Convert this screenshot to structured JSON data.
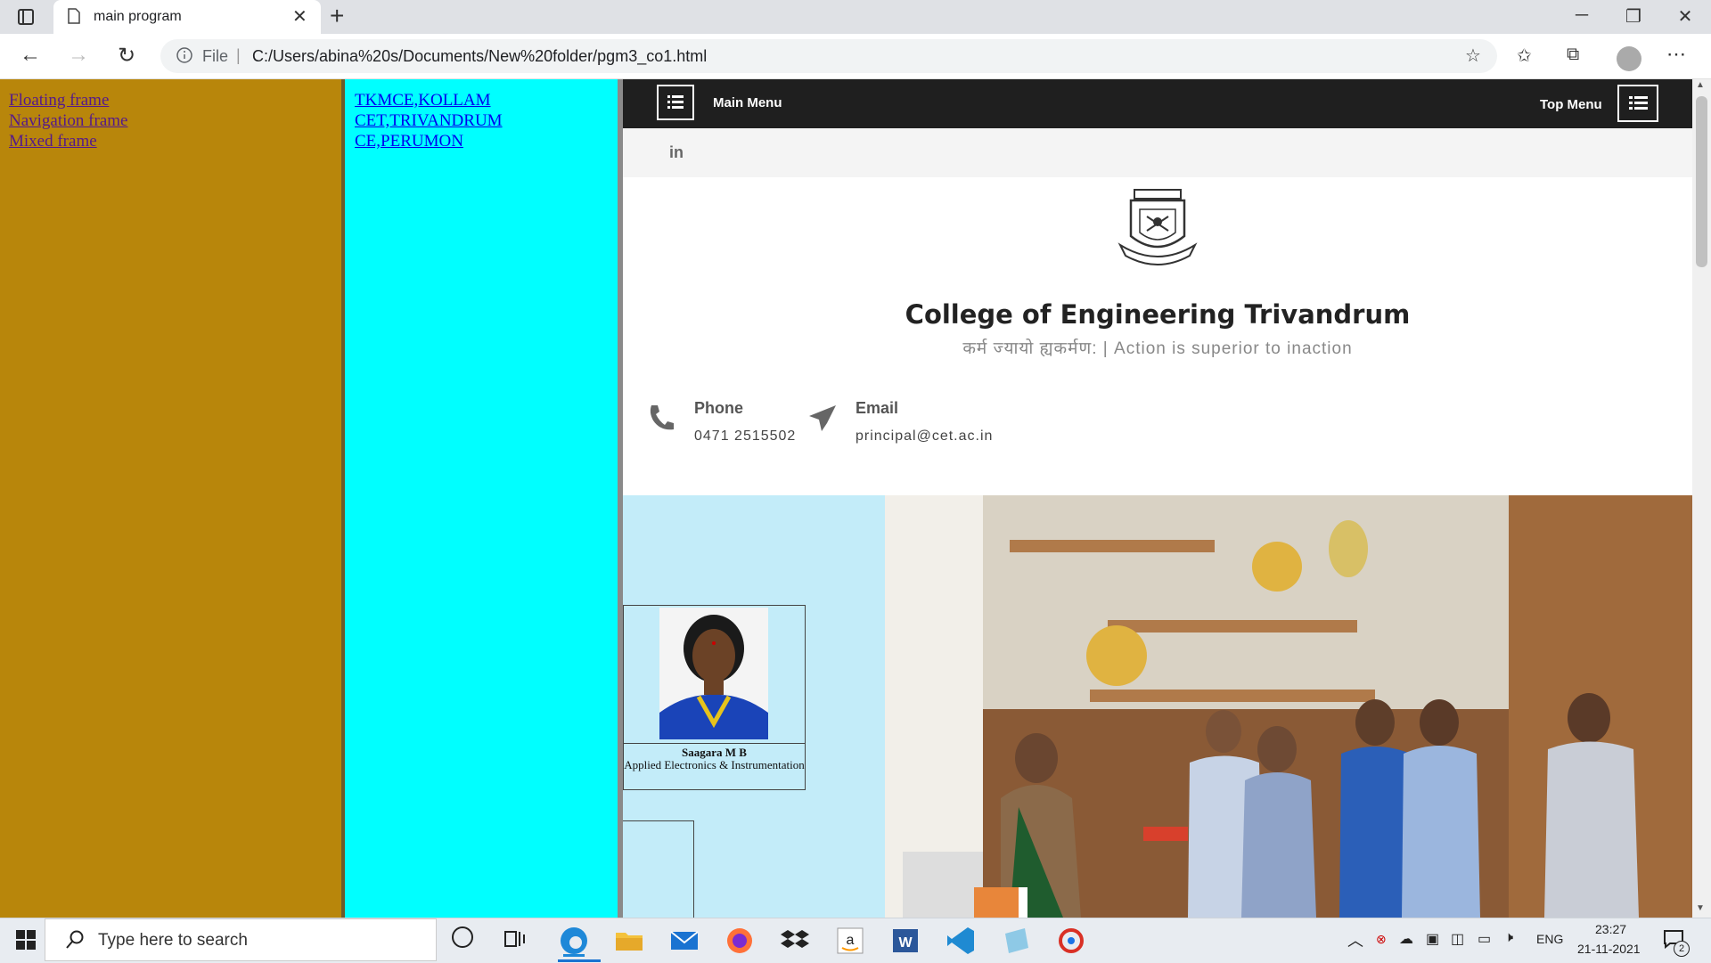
{
  "browser": {
    "tab_title": "main program",
    "url_scheme": "File",
    "url": "C:/Users/abina%20s/Documents/New%20folder/pgm3_co1.html"
  },
  "left_frame": {
    "links": [
      "Floating frame",
      "Navigation frame",
      "Mixed frame"
    ]
  },
  "middle_frame": {
    "links": [
      "TKMCE,KOLLAM",
      "CET,TRIVANDRUM",
      "CE,PERUMON"
    ]
  },
  "site": {
    "main_menu_label": "Main Menu",
    "top_menu_label": "Top Menu",
    "social": "in",
    "college_name": "College of Engineering Trivandrum",
    "motto": "कर्म ज्यायो ह्यकर्मण: | Action is superior to inaction",
    "phone_label": "Phone",
    "phone_value": "0471 2515502",
    "email_label": "Email",
    "email_value": "principal@cet.ac.in",
    "profile_name": "Saagara M B",
    "profile_dept": "Applied Electronics & Instrumentation"
  },
  "taskbar": {
    "search_placeholder": "Type here to search",
    "language": "ENG",
    "time": "23:27",
    "date": "21-11-2021",
    "notification_count": "2"
  },
  "colors": {
    "left_frame_bg": "#b8860b",
    "middle_frame_bg": "#00ffff",
    "site_nav_bg": "#1f1f1f",
    "lower_left_bg": "#c3ecf9"
  }
}
